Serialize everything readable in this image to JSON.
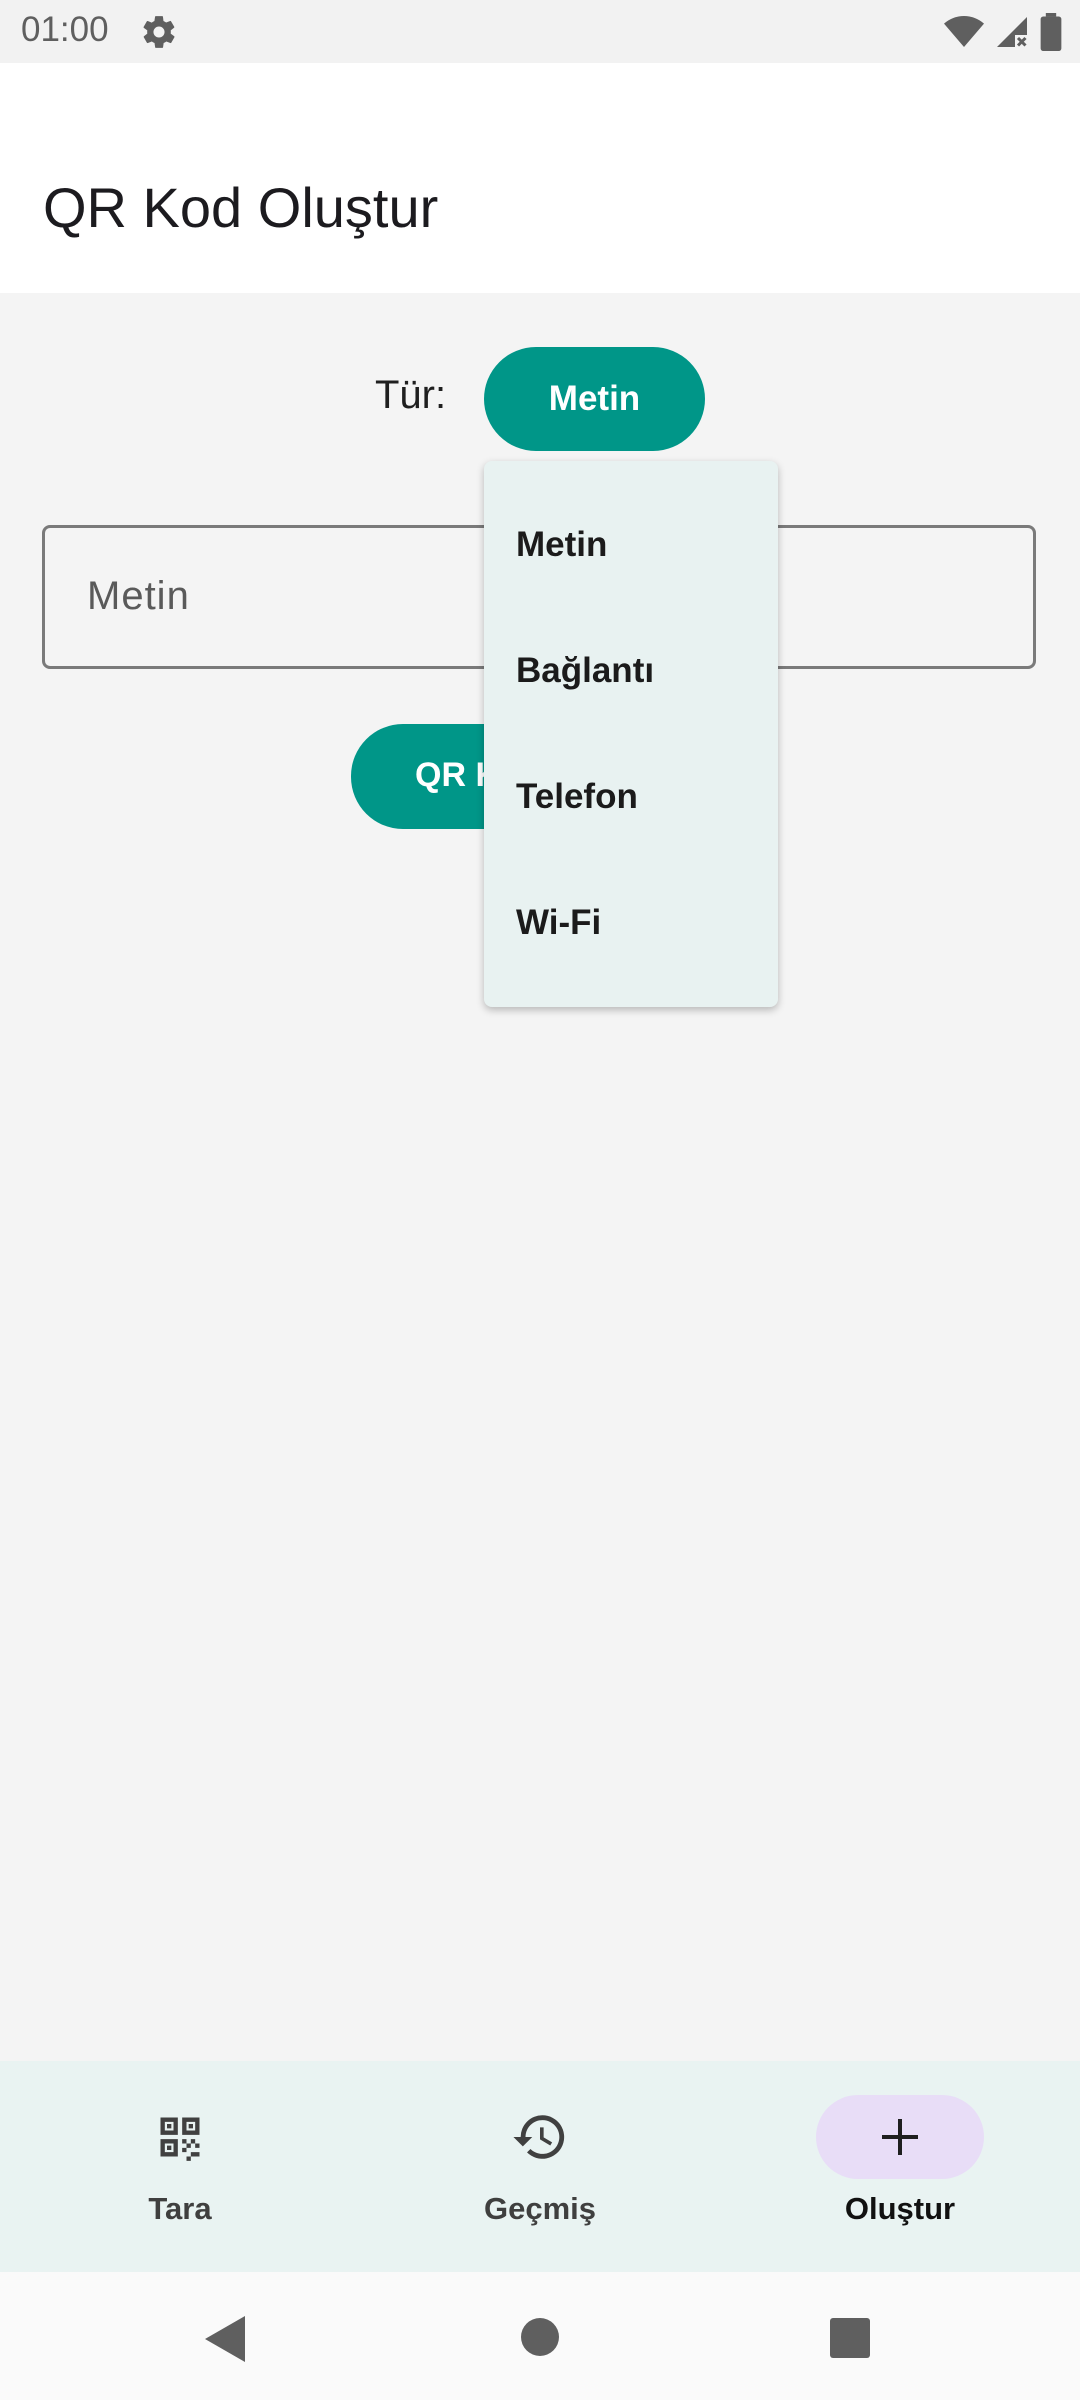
{
  "status_bar": {
    "time": "01:00"
  },
  "header": {
    "title": "QR Kod Oluştur"
  },
  "form": {
    "type_label": "Tür:",
    "type_selected": "Metin",
    "input_placeholder": "Metin",
    "create_button_label": "QR K"
  },
  "dropdown": {
    "items": [
      {
        "label": "Metin"
      },
      {
        "label": "Bağlantı"
      },
      {
        "label": "Telefon"
      },
      {
        "label": "Wi-Fi"
      }
    ]
  },
  "bottom_nav": {
    "items": [
      {
        "label": "Tara",
        "icon": "qr-code-icon"
      },
      {
        "label": "Geçmiş",
        "icon": "history-icon"
      },
      {
        "label": "Oluştur",
        "icon": "plus-icon",
        "active": true
      }
    ]
  },
  "colors": {
    "accent": "#009688",
    "nav_active_pill": "#e8ddf7"
  }
}
